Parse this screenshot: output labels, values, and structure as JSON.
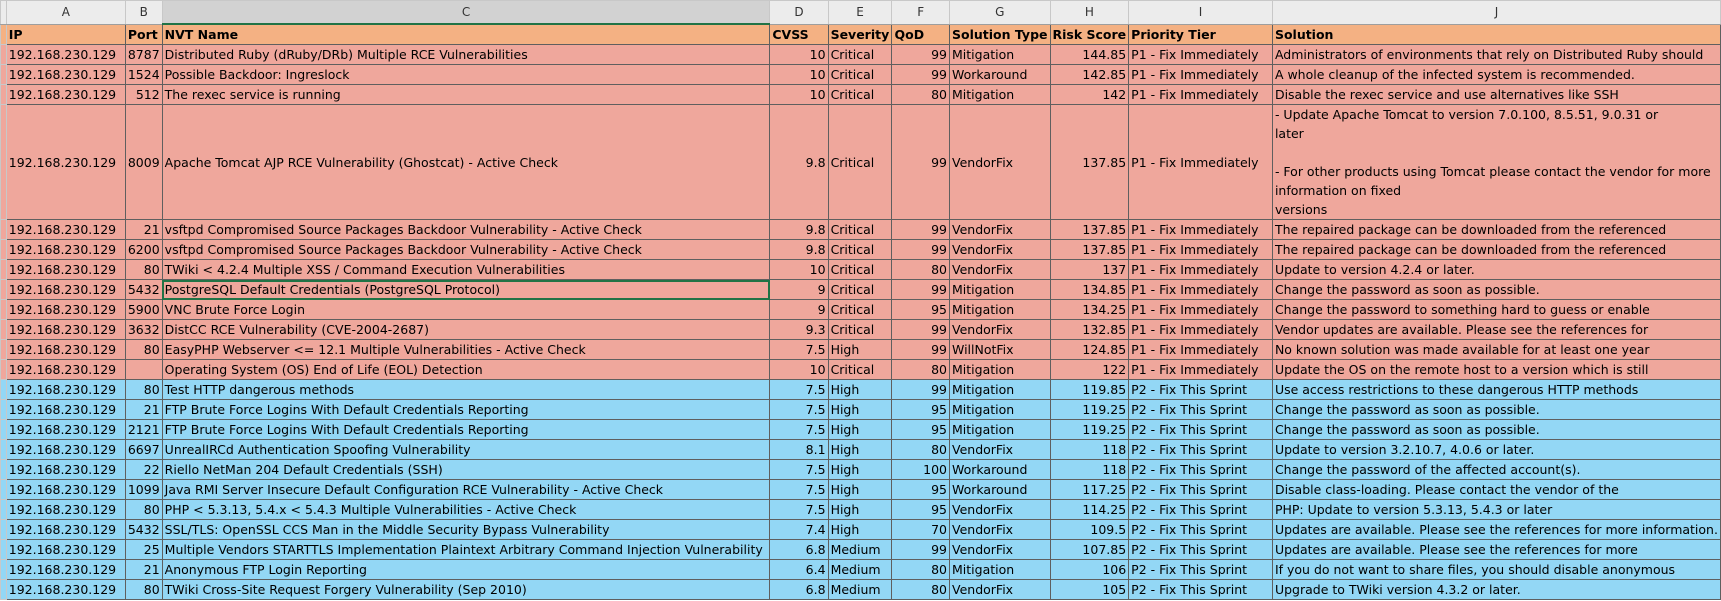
{
  "columns": [
    "A",
    "B",
    "C",
    "D",
    "E",
    "F",
    "G",
    "H",
    "I",
    "J"
  ],
  "header": {
    "ip": "IP",
    "port": "Port",
    "nvt": "NVT Name",
    "cvss": "CVSS",
    "severity": "Severity",
    "qod": "QoD",
    "solution_type": "Solution Type",
    "risk": "Risk Score",
    "tier": "Priority Tier",
    "solution": "Solution"
  },
  "rows": [
    {
      "ip": "192.168.230.129",
      "port": "8787",
      "nvt": "Distributed Ruby (dRuby/DRb) Multiple RCE Vulnerabilities",
      "cvss": "10",
      "severity": "Critical",
      "qod": "99",
      "solution_type": "Mitigation",
      "risk": "144.85",
      "tier": "P1 - Fix Immediately",
      "solution": "Administrators of environments that rely on Distributed Ruby should"
    },
    {
      "ip": "192.168.230.129",
      "port": "1524",
      "nvt": "Possible Backdoor: Ingreslock",
      "cvss": "10",
      "severity": "Critical",
      "qod": "99",
      "solution_type": "Workaround",
      "risk": "142.85",
      "tier": "P1 - Fix Immediately",
      "solution": "A whole cleanup of the infected system is recommended."
    },
    {
      "ip": "192.168.230.129",
      "port": "512",
      "nvt": "The rexec service is running",
      "cvss": "10",
      "severity": "Critical",
      "qod": "80",
      "solution_type": "Mitigation",
      "risk": "142",
      "tier": "P1 - Fix Immediately",
      "solution": "Disable the rexec service and use alternatives like SSH"
    },
    {
      "ip": "192.168.230.129",
      "port": "8009",
      "nvt": "Apache Tomcat AJP RCE Vulnerability (Ghostcat) - Active Check",
      "cvss": "9.8",
      "severity": "Critical",
      "qod": "99",
      "solution_type": "VendorFix",
      "risk": "137.85",
      "tier": "P1 - Fix Immediately",
      "solution_lines": [
        "- Update Apache Tomcat to version 7.0.100, 8.5.51, 9.0.31 or",
        "  later",
        "",
        "  - For other products using Tomcat please contact the vendor for more",
        "information on fixed",
        "  versions"
      ]
    },
    {
      "ip": "192.168.230.129",
      "port": "21",
      "nvt": "vsftpd Compromised Source Packages Backdoor Vulnerability - Active Check",
      "cvss": "9.8",
      "severity": "Critical",
      "qod": "99",
      "solution_type": "VendorFix",
      "risk": "137.85",
      "tier": "P1 - Fix Immediately",
      "solution": "The repaired package can be downloaded from the referenced"
    },
    {
      "ip": "192.168.230.129",
      "port": "6200",
      "nvt": "vsftpd Compromised Source Packages Backdoor Vulnerability - Active Check",
      "cvss": "9.8",
      "severity": "Critical",
      "qod": "99",
      "solution_type": "VendorFix",
      "risk": "137.85",
      "tier": "P1 - Fix Immediately",
      "solution": "The repaired package can be downloaded from the referenced"
    },
    {
      "ip": "192.168.230.129",
      "port": "80",
      "nvt": "TWiki < 4.2.4 Multiple XSS / Command Execution Vulnerabilities",
      "cvss": "10",
      "severity": "Critical",
      "qod": "80",
      "solution_type": "VendorFix",
      "risk": "137",
      "tier": "P1 - Fix Immediately",
      "solution": "Update to version 4.2.4 or later."
    },
    {
      "ip": "192.168.230.129",
      "port": "5432",
      "nvt": "PostgreSQL Default Credentials (PostgreSQL Protocol)",
      "cvss": "9",
      "severity": "Critical",
      "qod": "99",
      "solution_type": "Mitigation",
      "risk": "134.85",
      "tier": "P1 - Fix Immediately",
      "solution": "Change the password as soon as possible.",
      "selected": true
    },
    {
      "ip": "192.168.230.129",
      "port": "5900",
      "nvt": "VNC Brute Force Login",
      "cvss": "9",
      "severity": "Critical",
      "qod": "95",
      "solution_type": "Mitigation",
      "risk": "134.25",
      "tier": "P1 - Fix Immediately",
      "solution": "Change the password to something hard to guess or enable"
    },
    {
      "ip": "192.168.230.129",
      "port": "3632",
      "nvt": "DistCC RCE Vulnerability (CVE-2004-2687)",
      "cvss": "9.3",
      "severity": "Critical",
      "qod": "99",
      "solution_type": "VendorFix",
      "risk": "132.85",
      "tier": "P1 - Fix Immediately",
      "solution": "Vendor updates are available. Please see the references for"
    },
    {
      "ip": "192.168.230.129",
      "port": "80",
      "nvt": "EasyPHP Webserver <= 12.1 Multiple Vulnerabilities - Active Check",
      "cvss": "7.5",
      "severity": "High",
      "qod": "99",
      "solution_type": "WillNotFix",
      "risk": "124.85",
      "tier": "P1 - Fix Immediately",
      "solution": "No known solution was made available for at least one year"
    },
    {
      "ip": "192.168.230.129",
      "port": "",
      "nvt": "Operating System (OS) End of Life (EOL) Detection",
      "cvss": "10",
      "severity": "Critical",
      "qod": "80",
      "solution_type": "Mitigation",
      "risk": "122",
      "tier": "P1 - Fix Immediately",
      "solution": "Update the OS on the remote host to a version which is still"
    },
    {
      "ip": "192.168.230.129",
      "port": "80",
      "nvt": "Test HTTP dangerous methods",
      "cvss": "7.5",
      "severity": "High",
      "qod": "99",
      "solution_type": "Mitigation",
      "risk": "119.85",
      "tier": "P2 - Fix This Sprint",
      "solution": "Use access restrictions to these dangerous HTTP methods"
    },
    {
      "ip": "192.168.230.129",
      "port": "21",
      "nvt": "FTP Brute Force Logins With Default Credentials Reporting",
      "cvss": "7.5",
      "severity": "High",
      "qod": "95",
      "solution_type": "Mitigation",
      "risk": "119.25",
      "tier": "P2 - Fix This Sprint",
      "solution": "Change the password as soon as possible."
    },
    {
      "ip": "192.168.230.129",
      "port": "2121",
      "nvt": "FTP Brute Force Logins With Default Credentials Reporting",
      "cvss": "7.5",
      "severity": "High",
      "qod": "95",
      "solution_type": "Mitigation",
      "risk": "119.25",
      "tier": "P2 - Fix This Sprint",
      "solution": "Change the password as soon as possible."
    },
    {
      "ip": "192.168.230.129",
      "port": "6697",
      "nvt": "UnrealIRCd Authentication Spoofing Vulnerability",
      "cvss": "8.1",
      "severity": "High",
      "qod": "80",
      "solution_type": "VendorFix",
      "risk": "118",
      "tier": "P2 - Fix This Sprint",
      "solution": "Update to version 3.2.10.7, 4.0.6 or later."
    },
    {
      "ip": "192.168.230.129",
      "port": "22",
      "nvt": "Riello NetMan 204 Default Credentials (SSH)",
      "cvss": "7.5",
      "severity": "High",
      "qod": "100",
      "solution_type": "Workaround",
      "risk": "118",
      "tier": "P2 - Fix This Sprint",
      "solution": "Change the password of the affected account(s)."
    },
    {
      "ip": "192.168.230.129",
      "port": "1099",
      "nvt": "Java RMI Server Insecure Default Configuration RCE Vulnerability - Active Check",
      "cvss": "7.5",
      "severity": "High",
      "qod": "95",
      "solution_type": "Workaround",
      "risk": "117.25",
      "tier": "P2 - Fix This Sprint",
      "solution": "Disable class-loading. Please contact the vendor of the"
    },
    {
      "ip": "192.168.230.129",
      "port": "80",
      "nvt": "PHP < 5.3.13, 5.4.x < 5.4.3 Multiple Vulnerabilities - Active Check",
      "cvss": "7.5",
      "severity": "High",
      "qod": "95",
      "solution_type": "VendorFix",
      "risk": "114.25",
      "tier": "P2 - Fix This Sprint",
      "solution": "PHP: Update to version 5.3.13, 5.4.3 or later"
    },
    {
      "ip": "192.168.230.129",
      "port": "5432",
      "nvt": "SSL/TLS: OpenSSL CCS Man in the Middle Security Bypass Vulnerability",
      "cvss": "7.4",
      "severity": "High",
      "qod": "70",
      "solution_type": "VendorFix",
      "risk": "109.5",
      "tier": "P2 - Fix This Sprint",
      "solution": "Updates are available. Please see the references for more information."
    },
    {
      "ip": "192.168.230.129",
      "port": "25",
      "nvt": "Multiple Vendors STARTTLS Implementation Plaintext Arbitrary Command Injection Vulnerability",
      "cvss": "6.8",
      "severity": "Medium",
      "qod": "99",
      "solution_type": "VendorFix",
      "risk": "107.85",
      "tier": "P2 - Fix This Sprint",
      "solution": "Updates are available. Please see the references for more"
    },
    {
      "ip": "192.168.230.129",
      "port": "21",
      "nvt": "Anonymous FTP Login Reporting",
      "cvss": "6.4",
      "severity": "Medium",
      "qod": "80",
      "solution_type": "Mitigation",
      "risk": "106",
      "tier": "P2 - Fix This Sprint",
      "solution": "If you do not want to share files, you should disable anonymous"
    },
    {
      "ip": "192.168.230.129",
      "port": "80",
      "nvt": "TWiki Cross-Site Request Forgery Vulnerability (Sep 2010)",
      "cvss": "6.8",
      "severity": "Medium",
      "qod": "80",
      "solution_type": "VendorFix",
      "risk": "105",
      "tier": "P2 - Fix This Sprint",
      "solution": "Upgrade to TWiki version 4.3.2 or later."
    }
  ]
}
